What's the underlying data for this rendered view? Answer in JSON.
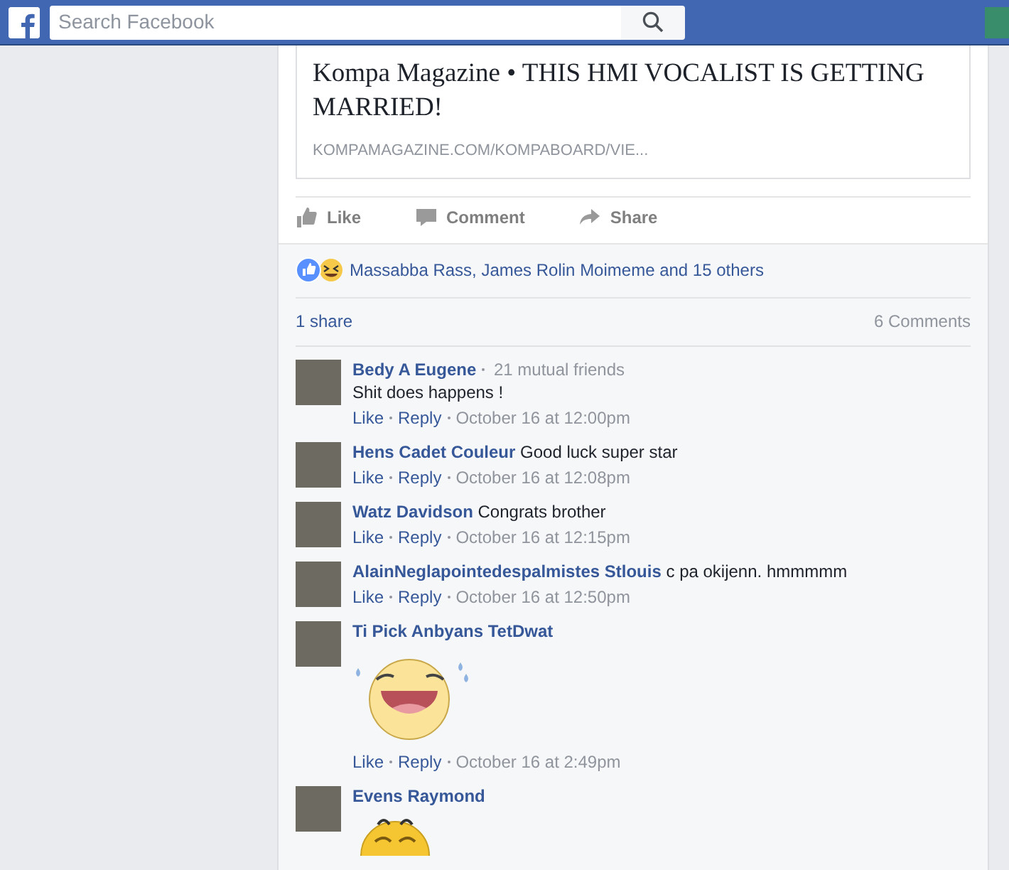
{
  "top_bar": {
    "search": {
      "placeholder": "Search Facebook"
    }
  },
  "link_preview": {
    "title": "Kompa Magazine • THIS HMI VOCALIST IS GETTING MARRIED!",
    "domain": "KOMPAMAGAZINE.COM/KOMPABOARD/VIE..."
  },
  "actions": [
    {
      "label": "Like",
      "kind": "like"
    },
    {
      "label": "Comment",
      "kind": "comment"
    },
    {
      "label": "Share",
      "kind": "share"
    }
  ],
  "reactions": {
    "text": "Massabba Rass, James Rolin Moimeme and 15 others"
  },
  "shares": "1 share",
  "comment_count": "6 Comments",
  "comments": [
    {
      "kind": "text",
      "name": "Bedy A Eugene",
      "context": "21 mutual friends",
      "text": "Shit does happens !",
      "like": "Like",
      "reply": "Reply",
      "time": "October 16 at 12:00pm"
    },
    {
      "kind": "text",
      "name": "Hens Cadet Couleur",
      "text": "Good luck super star",
      "like": "Like",
      "reply": "Reply",
      "time": "October 16 at 12:08pm"
    },
    {
      "kind": "text",
      "name": "Watz Davidson",
      "text": "Congrats brother",
      "like": "Like",
      "reply": "Reply",
      "time": "October 16 at 12:15pm"
    },
    {
      "kind": "text",
      "name": "AlainNeglapointedespalmistes Stlouis",
      "text": "c pa okijenn. hmmmmm",
      "like": "Like",
      "reply": "Reply",
      "time": "October 16 at 12:50pm"
    },
    {
      "kind": "laugh",
      "name": "Ti Pick Anbyans TetDwat",
      "like": "Like",
      "reply": "Reply",
      "time": "October 16 at 2:49pm"
    },
    {
      "kind": "grin",
      "name": "Evens Raymond"
    }
  ]
}
